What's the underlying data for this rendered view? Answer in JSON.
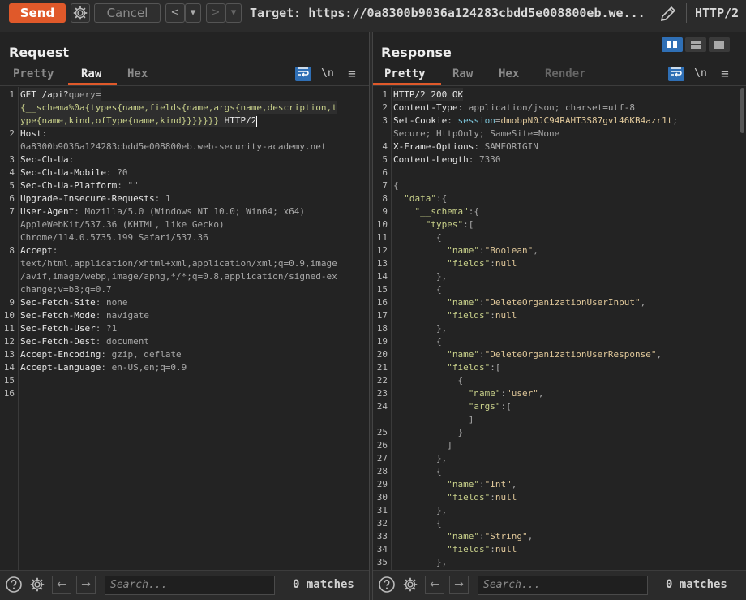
{
  "toolbar": {
    "send_label": "Send",
    "cancel_label": "Cancel",
    "back_label": "<",
    "forward_label": ">",
    "dropdown_glyph": "▾",
    "target_text": "Target: https://0a8300b9036a124283cbdd5e008800eb.we...",
    "protocol_label": "HTTP/2"
  },
  "request": {
    "title": "Request",
    "tabs": [
      "Pretty",
      "Raw",
      "Hex"
    ],
    "active_tab": "Raw",
    "icon_newline": "\\n",
    "icon_menu": "≡",
    "search_placeholder": "Search...",
    "matches": "0 matches",
    "lines": [
      {
        "n": "1",
        "segs": [
          [
            "k",
            "GET /api?"
          ],
          [
            "p",
            "query="
          ]
        ]
      },
      {
        "n": "",
        "segs": [
          [
            "g",
            "{__schema%0a{types{name,fields{name,args{name,description,t"
          ]
        ]
      },
      {
        "n": "",
        "segs": [
          [
            "g",
            "ype{name,kind,ofType{name,kind}}}}}}} "
          ],
          [
            "k",
            "HTTP/2"
          ]
        ]
      },
      {
        "n": "2",
        "segs": [
          [
            "k",
            "Host"
          ],
          [
            "p",
            ":"
          ]
        ]
      },
      {
        "n": "",
        "segs": [
          [
            "p",
            "0a8300b9036a124283cbdd5e008800eb.web-security-academy.net"
          ]
        ]
      },
      {
        "n": "3",
        "segs": [
          [
            "k",
            "Sec-Ch-Ua"
          ],
          [
            "p",
            ":"
          ]
        ]
      },
      {
        "n": "4",
        "segs": [
          [
            "k",
            "Sec-Ch-Ua-Mobile"
          ],
          [
            "p",
            ": ?0"
          ]
        ]
      },
      {
        "n": "5",
        "segs": [
          [
            "k",
            "Sec-Ch-Ua-Platform"
          ],
          [
            "p",
            ": \"\""
          ]
        ]
      },
      {
        "n": "6",
        "segs": [
          [
            "k",
            "Upgrade-Insecure-Requests"
          ],
          [
            "p",
            ": 1"
          ]
        ]
      },
      {
        "n": "7",
        "segs": [
          [
            "k",
            "User-Agent"
          ],
          [
            "p",
            ": Mozilla/5.0 (Windows NT 10.0; Win64; x64)"
          ]
        ]
      },
      {
        "n": "",
        "segs": [
          [
            "p",
            "AppleWebKit/537.36 (KHTML, like Gecko)"
          ]
        ]
      },
      {
        "n": "",
        "segs": [
          [
            "p",
            "Chrome/114.0.5735.199 Safari/537.36"
          ]
        ]
      },
      {
        "n": "8",
        "segs": [
          [
            "k",
            "Accept"
          ],
          [
            "p",
            ":"
          ]
        ]
      },
      {
        "n": "",
        "segs": [
          [
            "p",
            "text/html,application/xhtml+xml,application/xml;q=0.9,image"
          ]
        ]
      },
      {
        "n": "",
        "segs": [
          [
            "p",
            "/avif,image/webp,image/apng,*/*;q=0.8,application/signed-ex"
          ]
        ]
      },
      {
        "n": "",
        "segs": [
          [
            "p",
            "change;v=b3;q=0.7"
          ]
        ]
      },
      {
        "n": "9",
        "segs": [
          [
            "k",
            "Sec-Fetch-Site"
          ],
          [
            "p",
            ": none"
          ]
        ]
      },
      {
        "n": "10",
        "segs": [
          [
            "k",
            "Sec-Fetch-Mode"
          ],
          [
            "p",
            ": navigate"
          ]
        ]
      },
      {
        "n": "11",
        "segs": [
          [
            "k",
            "Sec-Fetch-User"
          ],
          [
            "p",
            ": ?1"
          ]
        ]
      },
      {
        "n": "12",
        "segs": [
          [
            "k",
            "Sec-Fetch-Dest"
          ],
          [
            "p",
            ": document"
          ]
        ]
      },
      {
        "n": "13",
        "segs": [
          [
            "k",
            "Accept-Encoding"
          ],
          [
            "p",
            ": gzip, deflate"
          ]
        ]
      },
      {
        "n": "14",
        "segs": [
          [
            "k",
            "Accept-Language"
          ],
          [
            "p",
            ": en-US,en;q=0.9"
          ]
        ]
      },
      {
        "n": "15",
        "segs": []
      },
      {
        "n": "16",
        "segs": []
      }
    ]
  },
  "response": {
    "title": "Response",
    "tabs": [
      "Pretty",
      "Raw",
      "Hex",
      "Render"
    ],
    "active_tab": "Pretty",
    "icon_newline": "\\n",
    "icon_menu": "≡",
    "search_placeholder": "Search...",
    "matches": "0 matches",
    "lines": [
      {
        "n": "1",
        "segs": [
          [
            "k",
            "HTTP/2 200 OK"
          ]
        ]
      },
      {
        "n": "2",
        "segs": [
          [
            "k",
            "Content-Type"
          ],
          [
            "p",
            ": application/json; charset=utf-8"
          ]
        ]
      },
      {
        "n": "3",
        "segs": [
          [
            "k",
            "Set-Cookie"
          ],
          [
            "p",
            ": "
          ],
          [
            "a",
            "session"
          ],
          [
            "p",
            "="
          ],
          [
            "s",
            "dmobpN0JC94RAHT3S87gvl46KB4azr1t"
          ],
          [
            "p",
            ";"
          ]
        ]
      },
      {
        "n": "",
        "segs": [
          [
            "p",
            "Secure; HttpOnly; SameSite=None"
          ]
        ]
      },
      {
        "n": "4",
        "segs": [
          [
            "k",
            "X-Frame-Options"
          ],
          [
            "p",
            ": SAMEORIGIN"
          ]
        ]
      },
      {
        "n": "5",
        "segs": [
          [
            "k",
            "Content-Length"
          ],
          [
            "p",
            ": 7330"
          ]
        ]
      },
      {
        "n": "6",
        "segs": []
      },
      {
        "n": "7",
        "segs": [
          [
            "p",
            "{"
          ]
        ]
      },
      {
        "n": "8",
        "segs": [
          [
            "p",
            "  "
          ],
          [
            "kw",
            "\"data\""
          ],
          [
            "p",
            ":{"
          ]
        ]
      },
      {
        "n": "9",
        "segs": [
          [
            "p",
            "    "
          ],
          [
            "kw",
            "\"__schema\""
          ],
          [
            "p",
            ":{"
          ]
        ]
      },
      {
        "n": "10",
        "segs": [
          [
            "p",
            "      "
          ],
          [
            "kw",
            "\"types\""
          ],
          [
            "p",
            ":["
          ]
        ]
      },
      {
        "n": "11",
        "segs": [
          [
            "p",
            "        {"
          ]
        ]
      },
      {
        "n": "12",
        "segs": [
          [
            "p",
            "          "
          ],
          [
            "kw",
            "\"name\""
          ],
          [
            "p",
            ":"
          ],
          [
            "s",
            "\"Boolean\""
          ],
          [
            "p",
            ","
          ]
        ]
      },
      {
        "n": "13",
        "segs": [
          [
            "p",
            "          "
          ],
          [
            "kw",
            "\"fields\""
          ],
          [
            "p",
            ":"
          ],
          [
            "s",
            "null"
          ]
        ]
      },
      {
        "n": "14",
        "segs": [
          [
            "p",
            "        },"
          ]
        ]
      },
      {
        "n": "15",
        "segs": [
          [
            "p",
            "        {"
          ]
        ]
      },
      {
        "n": "16",
        "segs": [
          [
            "p",
            "          "
          ],
          [
            "kw",
            "\"name\""
          ],
          [
            "p",
            ":"
          ],
          [
            "s",
            "\"DeleteOrganizationUserInput\""
          ],
          [
            "p",
            ","
          ]
        ]
      },
      {
        "n": "17",
        "segs": [
          [
            "p",
            "          "
          ],
          [
            "kw",
            "\"fields\""
          ],
          [
            "p",
            ":"
          ],
          [
            "s",
            "null"
          ]
        ]
      },
      {
        "n": "18",
        "segs": [
          [
            "p",
            "        },"
          ]
        ]
      },
      {
        "n": "19",
        "segs": [
          [
            "p",
            "        {"
          ]
        ]
      },
      {
        "n": "20",
        "segs": [
          [
            "p",
            "          "
          ],
          [
            "kw",
            "\"name\""
          ],
          [
            "p",
            ":"
          ],
          [
            "s",
            "\"DeleteOrganizationUserResponse\""
          ],
          [
            "p",
            ","
          ]
        ]
      },
      {
        "n": "21",
        "segs": [
          [
            "p",
            "          "
          ],
          [
            "kw",
            "\"fields\""
          ],
          [
            "p",
            ":["
          ]
        ]
      },
      {
        "n": "22",
        "segs": [
          [
            "p",
            "            {"
          ]
        ]
      },
      {
        "n": "23",
        "segs": [
          [
            "p",
            "              "
          ],
          [
            "kw",
            "\"name\""
          ],
          [
            "p",
            ":"
          ],
          [
            "s",
            "\"user\""
          ],
          [
            "p",
            ","
          ]
        ]
      },
      {
        "n": "24",
        "segs": [
          [
            "p",
            "              "
          ],
          [
            "kw",
            "\"args\""
          ],
          [
            "p",
            ":["
          ]
        ]
      },
      {
        "n": "",
        "segs": [
          [
            "p",
            "              ]"
          ]
        ]
      },
      {
        "n": "25",
        "segs": [
          [
            "p",
            "            }"
          ]
        ]
      },
      {
        "n": "26",
        "segs": [
          [
            "p",
            "          ]"
          ]
        ]
      },
      {
        "n": "27",
        "segs": [
          [
            "p",
            "        },"
          ]
        ]
      },
      {
        "n": "28",
        "segs": [
          [
            "p",
            "        {"
          ]
        ]
      },
      {
        "n": "29",
        "segs": [
          [
            "p",
            "          "
          ],
          [
            "kw",
            "\"name\""
          ],
          [
            "p",
            ":"
          ],
          [
            "s",
            "\"Int\""
          ],
          [
            "p",
            ","
          ]
        ]
      },
      {
        "n": "30",
        "segs": [
          [
            "p",
            "          "
          ],
          [
            "kw",
            "\"fields\""
          ],
          [
            "p",
            ":"
          ],
          [
            "s",
            "null"
          ]
        ]
      },
      {
        "n": "31",
        "segs": [
          [
            "p",
            "        },"
          ]
        ]
      },
      {
        "n": "32",
        "segs": [
          [
            "p",
            "        {"
          ]
        ]
      },
      {
        "n": "33",
        "segs": [
          [
            "p",
            "          "
          ],
          [
            "kw",
            "\"name\""
          ],
          [
            "p",
            ":"
          ],
          [
            "s",
            "\"String\""
          ],
          [
            "p",
            ","
          ]
        ]
      },
      {
        "n": "34",
        "segs": [
          [
            "p",
            "          "
          ],
          [
            "kw",
            "\"fields\""
          ],
          [
            "p",
            ":"
          ],
          [
            "s",
            "null"
          ]
        ]
      },
      {
        "n": "35",
        "segs": [
          [
            "p",
            "        },"
          ]
        ]
      }
    ]
  },
  "colors": {
    "accent": "#e0592a",
    "toggle_active": "#2f6fb5"
  }
}
